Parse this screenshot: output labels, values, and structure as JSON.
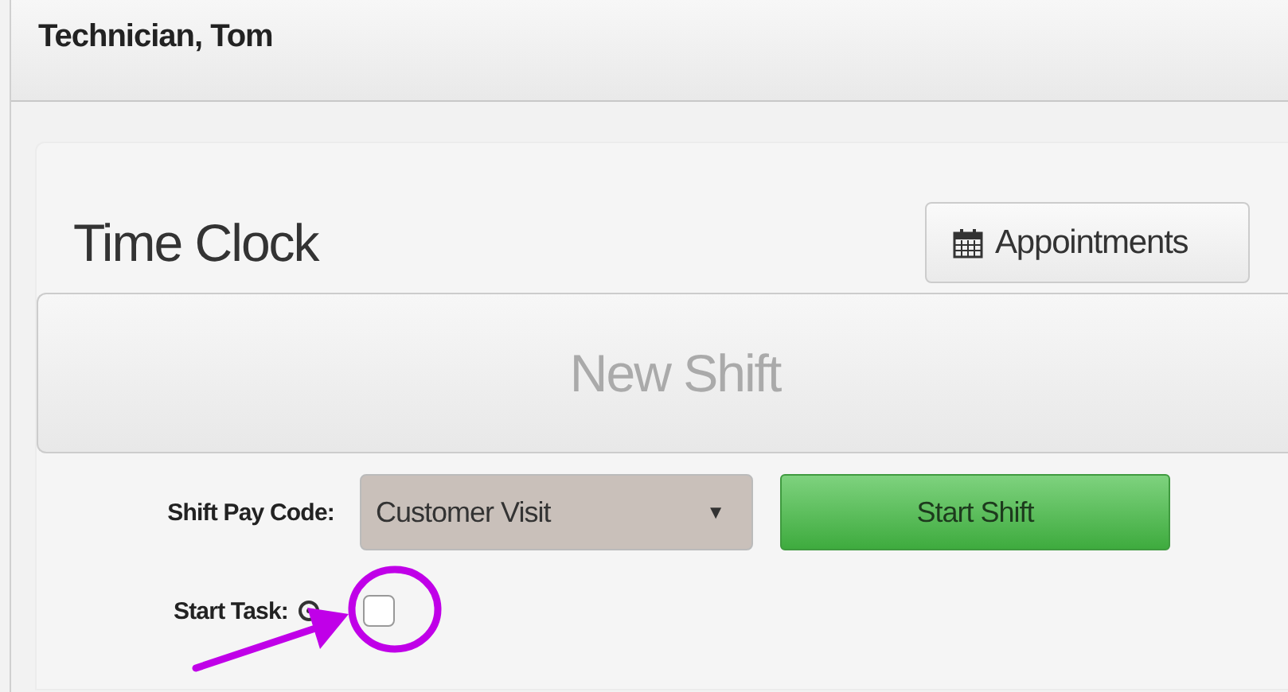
{
  "header": {
    "user_name": "Technician, Tom"
  },
  "time_clock": {
    "title": "Time Clock",
    "appointments_button": "Appointments",
    "shift_status": "New Shift",
    "pay_code": {
      "label": "Shift Pay Code:",
      "value": "Customer Visit",
      "caret": "▼"
    },
    "start_button": "Start Shift",
    "start_task": {
      "label": "Start Task:",
      "checked": false
    }
  }
}
